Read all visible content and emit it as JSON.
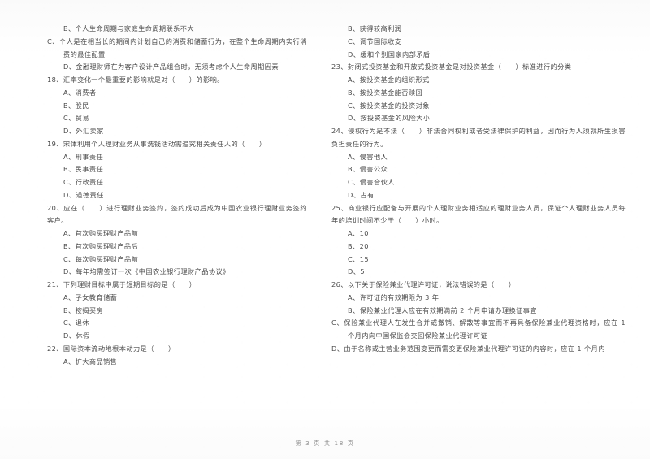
{
  "document": {
    "page_background_color": "#fdfdfd",
    "text_color": "#4a4a4a",
    "footer": "第 3 页 共 18 页"
  },
  "left_column": {
    "items": [
      {
        "type": "option",
        "text": "B、个人生命周期与家庭生命周期联系不大"
      },
      {
        "type": "option_wrap",
        "text": "C、个人是在相当长的期间内计划自己的消费和储蓄行为，在整个生命周期内实行消费的最佳配置"
      },
      {
        "type": "option",
        "text": "D、金融理财师在为客户设计产品组合时，无须考虑个人生命周期因素"
      },
      {
        "type": "stem",
        "text": "18、汇率变化一个最重要的影响就是对（　　）的影响。"
      },
      {
        "type": "option",
        "text": "A、消费者"
      },
      {
        "type": "option",
        "text": "B、股民"
      },
      {
        "type": "option",
        "text": "C、贸易"
      },
      {
        "type": "option",
        "text": "D、外汇卖家"
      },
      {
        "type": "stem",
        "text": "19、宋体利用个人理财业务从事洗钱活动需追究相关责任人的（　　）"
      },
      {
        "type": "option",
        "text": "A、刑事责任"
      },
      {
        "type": "option",
        "text": "B、民事责任"
      },
      {
        "type": "option",
        "text": "C、行政责任"
      },
      {
        "type": "option",
        "text": "D、道德责任"
      },
      {
        "type": "stem",
        "text": "20、应在（　　）进行理财业务签约，签约成功后成为中国农业银行理财业务签约客户。"
      },
      {
        "type": "option",
        "text": "A、首次购买理财产品前"
      },
      {
        "type": "option",
        "text": "B、首次购买理财产品后"
      },
      {
        "type": "option",
        "text": "C、每次购买理财产品前"
      },
      {
        "type": "option",
        "text": "D、每年均需签订一次《中国农业银行理财产品协议》"
      },
      {
        "type": "stem",
        "text": "21、下列理财目标中属于短期目标的是（　　）"
      },
      {
        "type": "option",
        "text": "A、子女教育储蓄"
      },
      {
        "type": "option",
        "text": "B、按揭买房"
      },
      {
        "type": "option",
        "text": "C、退休"
      },
      {
        "type": "option",
        "text": "D、休假"
      },
      {
        "type": "stem",
        "text": "22、国际资本流动地根本动力是（　　）"
      },
      {
        "type": "option",
        "text": "A、扩大商品销售"
      }
    ]
  },
  "right_column": {
    "items": [
      {
        "type": "option",
        "text": "B、获得较高利润"
      },
      {
        "type": "option",
        "text": "C、调节国际收支"
      },
      {
        "type": "option",
        "text": "D、缓和个别国家内部矛盾"
      },
      {
        "type": "stem",
        "text": "23、封闭式投资基金和开放式投资基金是对投资基金（　　）标准进行的分类"
      },
      {
        "type": "option",
        "text": "A、按投资基金的组织形式"
      },
      {
        "type": "option",
        "text": "B、按投资基金能否赎回"
      },
      {
        "type": "option",
        "text": "C、按投资基金的投资对象"
      },
      {
        "type": "option",
        "text": "D、按投资基金的风险大小"
      },
      {
        "type": "stem_wrap",
        "text": "24、侵权行为是不法（　　）非法合同权利或者受法律保护的利益，因而行为人须就所生损害负担责任的行为。"
      },
      {
        "type": "option",
        "text": "A、侵害他人"
      },
      {
        "type": "option",
        "text": "B、侵害公众"
      },
      {
        "type": "option",
        "text": "C、侵害合伙人"
      },
      {
        "type": "option",
        "text": "D、占有"
      },
      {
        "type": "stem_wrap",
        "text": "25、商业银行应配备与开展的个人理财业务相适应的理财业务人员，保证个人理财业务人员每年的培训时间不少于（　　）小时。"
      },
      {
        "type": "option",
        "text": "A、10"
      },
      {
        "type": "option",
        "text": "B、20"
      },
      {
        "type": "option",
        "text": "C、15"
      },
      {
        "type": "option",
        "text": "D、5"
      },
      {
        "type": "stem",
        "text": "26、以下关于保险兼业代理许可证，说法错误的是（　　）"
      },
      {
        "type": "option",
        "text": "A、许可证的有效期限为 3 年"
      },
      {
        "type": "option",
        "text": "B、保险兼业代理人应在有效期满前 2 个月申请办理换证事宜"
      },
      {
        "type": "option_wrap",
        "text": "C、保险兼业代理人在发生合并或撤销、解散等事宜而不再具备保险兼业代理资格时，应在 1 个月内向中国保监会交回保险兼业代理许可证"
      },
      {
        "type": "option_wrap",
        "text": "D、由于名称或主营业务范围变更而需变更保险兼业代理许可证的内容时，应在 1 个月内"
      }
    ]
  }
}
